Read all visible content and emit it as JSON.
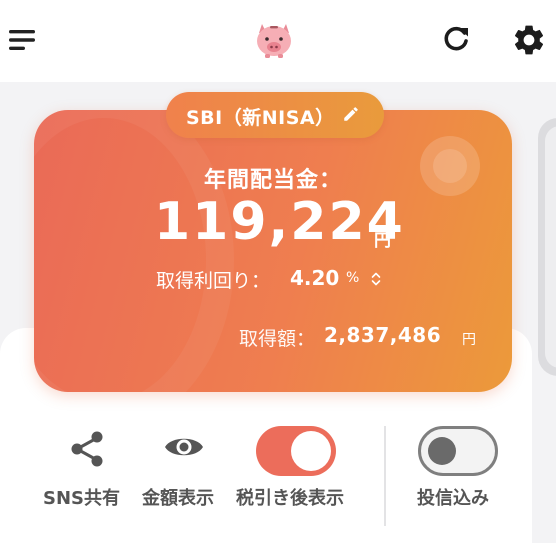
{
  "app": {
    "logo_icon": "piggy-bank",
    "accent_color": "#ec6d5b"
  },
  "header": {
    "menu_icon": "hamburger-menu",
    "refresh_icon": "refresh",
    "settings_icon": "gear"
  },
  "card": {
    "account_name": "SBI（新NISA）",
    "edit_icon": "pencil",
    "annual_dividend_label": "年間配当金：",
    "annual_dividend_amount": "119,224",
    "annual_dividend_unit": "円",
    "yield_label": "取得利回り：",
    "yield_value": "4.20",
    "yield_unit": "%",
    "sort_icon": "up-down-chevron",
    "cost_label": "取得額：",
    "cost_value": "2,837,486",
    "cost_unit": "円"
  },
  "controls": {
    "share_label": "SNS共有",
    "share_icon": "share",
    "amount_label": "金額表示",
    "amount_icon": "eye",
    "after_tax_label": "税引き後表示",
    "after_tax_on": true,
    "include_trust_label": "投信込み",
    "include_trust_on": false
  }
}
